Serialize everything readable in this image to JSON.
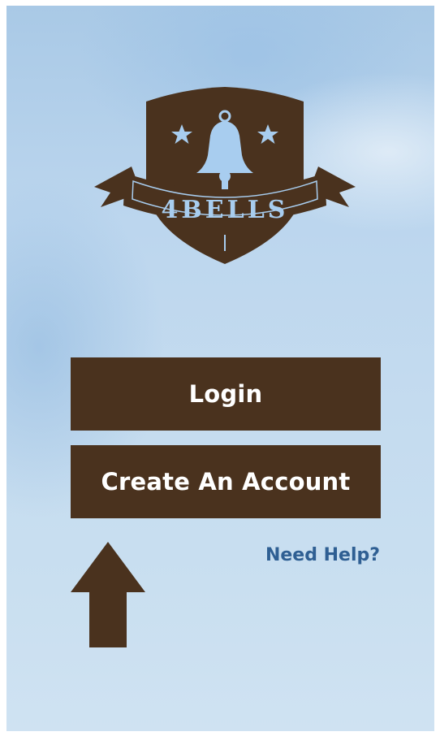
{
  "app": {
    "logo_text": "4BELLS"
  },
  "actions": {
    "login_label": "Login",
    "create_account_label": "Create An Account",
    "help_label": "Need Help?"
  },
  "colors": {
    "brand_brown": "#4a321e",
    "logo_accent": "#a8cdef",
    "help_link": "#2f5f93",
    "button_text": "#ffffff"
  },
  "icons": {
    "logo": "bell-shield-logo",
    "arrow": "up-arrow-icon"
  }
}
